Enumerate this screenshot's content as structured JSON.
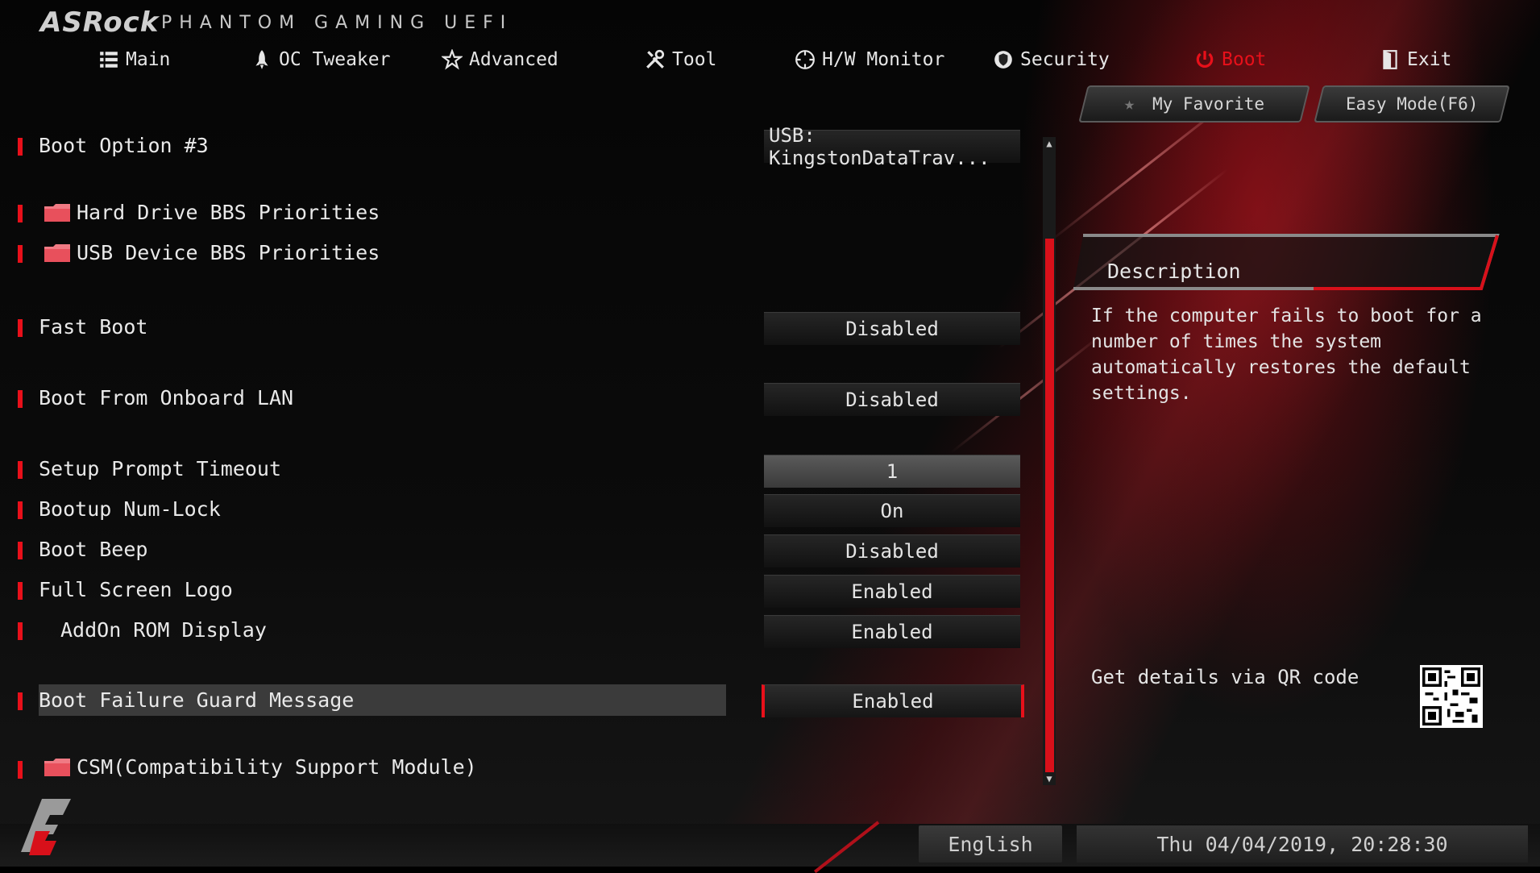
{
  "header": {
    "brand": "ASRock",
    "subtitle": "PHANTOM GAMING UEFI"
  },
  "tabs": [
    {
      "label": "Main",
      "icon": "list-icon"
    },
    {
      "label": "OC Tweaker",
      "icon": "rocket-icon"
    },
    {
      "label": "Advanced",
      "icon": "star-icon"
    },
    {
      "label": "Tool",
      "icon": "tools-icon"
    },
    {
      "label": "H/W Monitor",
      "icon": "monitor-gauge-icon"
    },
    {
      "label": "Security",
      "icon": "shield-icon"
    },
    {
      "label": "Boot",
      "icon": "power-icon",
      "active": true
    },
    {
      "label": "Exit",
      "icon": "exit-door-icon"
    }
  ],
  "buttons": {
    "favorite": "My Favorite",
    "easy_mode": "Easy Mode(F6)"
  },
  "settings": [
    {
      "label": "Boot Option #3",
      "value": "USB: KingstonDataTrav..."
    },
    {
      "label": "Hard Drive BBS Priorities",
      "submenu": true
    },
    {
      "label": "USB Device BBS Priorities",
      "submenu": true
    },
    {
      "label": "Fast Boot",
      "value": "Disabled"
    },
    {
      "label": "Boot From Onboard LAN",
      "value": "Disabled"
    },
    {
      "label": "Setup Prompt Timeout",
      "value": "1"
    },
    {
      "label": "Bootup Num-Lock",
      "value": "On"
    },
    {
      "label": "Boot Beep",
      "value": "Disabled"
    },
    {
      "label": "Full Screen Logo",
      "value": "Enabled"
    },
    {
      "label": "AddOn ROM Display",
      "value": "Enabled"
    },
    {
      "label": "Boot Failure Guard Message",
      "value": "Enabled",
      "selected": true
    },
    {
      "label": "CSM(Compatibility Support Module)",
      "submenu": true
    }
  ],
  "description": {
    "title": "Description",
    "text": "If the computer fails to boot for a number of times the system automatically restores the default settings."
  },
  "qr": {
    "label": "Get details via QR code"
  },
  "footer": {
    "language": "English",
    "datetime": "Thu 04/04/2019, 20:28:30"
  },
  "colors": {
    "accent": "#e8101a",
    "text": "#e8e8e8",
    "background": "#000000"
  }
}
